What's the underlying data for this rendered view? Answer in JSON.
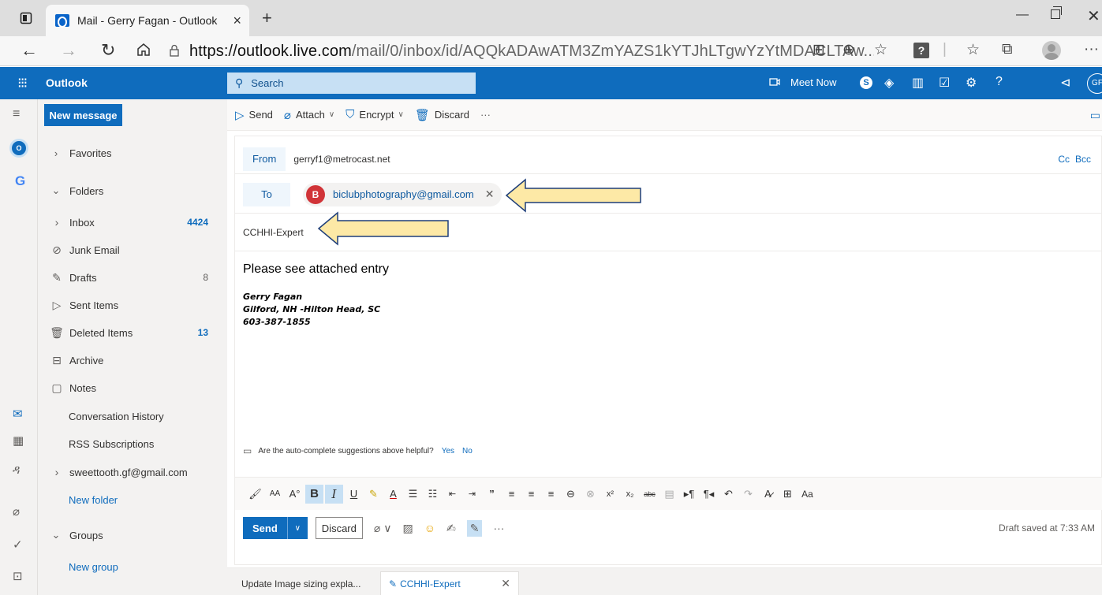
{
  "browser": {
    "tab_title": "Mail - Gerry Fagan - Outlook",
    "tab_close": "×",
    "new_tab": "+",
    "url_host": "https://outlook.live.com",
    "url_path": "/mail/0/inbox/id/AQQkADAwATM3ZmYAZS1kYTJhLTgwYzYtMDACLTAw...",
    "help_label": "?"
  },
  "header": {
    "app_name": "Outlook",
    "search_placeholder": "Search",
    "meet_now": "Meet Now",
    "avatar_initials": "GF"
  },
  "folder_pane": {
    "new_message": "New message",
    "favorites": "Favorites",
    "folders": "Folders",
    "items": [
      {
        "label": "Inbox",
        "count": "4424"
      },
      {
        "label": "Junk Email",
        "count": ""
      },
      {
        "label": "Drafts",
        "count": "8"
      },
      {
        "label": "Sent Items",
        "count": ""
      },
      {
        "label": "Deleted Items",
        "count": "13"
      },
      {
        "label": "Archive",
        "count": ""
      },
      {
        "label": "Notes",
        "count": ""
      },
      {
        "label": "Conversation History",
        "count": ""
      },
      {
        "label": "RSS Subscriptions",
        "count": ""
      }
    ],
    "account": "sweettooth.gf@gmail.com",
    "new_folder": "New folder",
    "groups": "Groups",
    "new_group": "New group"
  },
  "compose_toolbar": {
    "send": "Send",
    "attach": "Attach",
    "encrypt": "Encrypt",
    "discard": "Discard",
    "more": "···"
  },
  "compose": {
    "from_label": "From",
    "from_value": "gerryf1@metrocast.net",
    "cc": "Cc",
    "bcc": "Bcc",
    "to_label": "To",
    "recipient_initial": "B",
    "recipient_email": "biclubphotography@gmail.com",
    "subject": "CCHHI-Expert",
    "body_line": "Please see attached entry",
    "signature": [
      "Gerry Fagan",
      "Gilford, NH -Hilton Head, SC",
      "603-387-1855"
    ],
    "autocomplete_question": "Are the auto-complete suggestions above helpful?",
    "autocomplete_yes": "Yes",
    "autocomplete_no": "No",
    "send_button": "Send",
    "discard_button": "Discard",
    "draft_status": "Draft saved at 7:33 AM"
  },
  "draft_tabs": [
    {
      "label": "Update Image sizing expla..."
    },
    {
      "label": "CCHHI-Expert"
    }
  ],
  "colors": {
    "accent": "#0f6cbd",
    "annotation_arrow_fill": "#fde9a6",
    "annotation_arrow_stroke": "#1f3f7a"
  }
}
